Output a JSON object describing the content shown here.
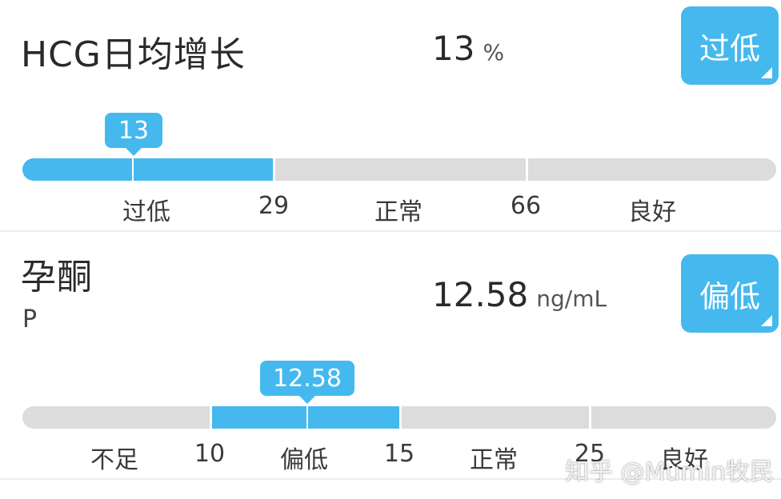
{
  "metrics": [
    {
      "title": "HCG日均增长",
      "subtitle": "",
      "value": "13",
      "unit": "%",
      "badge": "过低",
      "bubble": "13",
      "level": 13,
      "range_labels": [
        "过低",
        "29",
        "正常",
        "66",
        "良好"
      ]
    },
    {
      "title": "孕酮",
      "subtitle": "P",
      "value": "12.58",
      "unit": "ng/mL",
      "badge": "偏低",
      "bubble": "12.58",
      "level": 12.58,
      "range_labels": [
        "不足",
        "10",
        "偏低",
        "15",
        "正常",
        "25",
        "良好"
      ]
    }
  ],
  "watermark": "知乎 @Mumin牧民",
  "colors": {
    "accent": "#45b9ee",
    "track": "#dcdcdc",
    "text": "#2a2a2a"
  }
}
